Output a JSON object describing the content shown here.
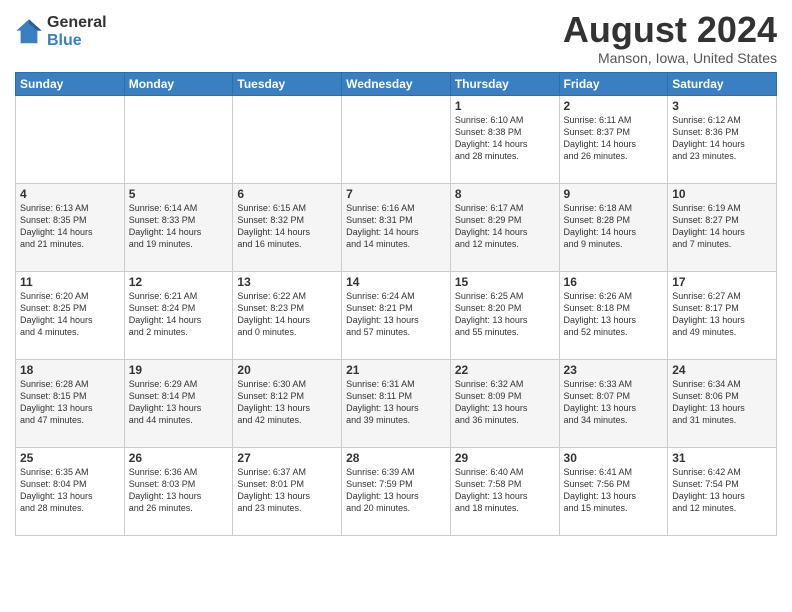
{
  "logo": {
    "general": "General",
    "blue": "Blue"
  },
  "title": "August 2024",
  "location": "Manson, Iowa, United States",
  "days_header": [
    "Sunday",
    "Monday",
    "Tuesday",
    "Wednesday",
    "Thursday",
    "Friday",
    "Saturday"
  ],
  "weeks": [
    [
      {
        "day": "",
        "info": ""
      },
      {
        "day": "",
        "info": ""
      },
      {
        "day": "",
        "info": ""
      },
      {
        "day": "",
        "info": ""
      },
      {
        "day": "1",
        "info": "Sunrise: 6:10 AM\nSunset: 8:38 PM\nDaylight: 14 hours\nand 28 minutes."
      },
      {
        "day": "2",
        "info": "Sunrise: 6:11 AM\nSunset: 8:37 PM\nDaylight: 14 hours\nand 26 minutes."
      },
      {
        "day": "3",
        "info": "Sunrise: 6:12 AM\nSunset: 8:36 PM\nDaylight: 14 hours\nand 23 minutes."
      }
    ],
    [
      {
        "day": "4",
        "info": "Sunrise: 6:13 AM\nSunset: 8:35 PM\nDaylight: 14 hours\nand 21 minutes."
      },
      {
        "day": "5",
        "info": "Sunrise: 6:14 AM\nSunset: 8:33 PM\nDaylight: 14 hours\nand 19 minutes."
      },
      {
        "day": "6",
        "info": "Sunrise: 6:15 AM\nSunset: 8:32 PM\nDaylight: 14 hours\nand 16 minutes."
      },
      {
        "day": "7",
        "info": "Sunrise: 6:16 AM\nSunset: 8:31 PM\nDaylight: 14 hours\nand 14 minutes."
      },
      {
        "day": "8",
        "info": "Sunrise: 6:17 AM\nSunset: 8:29 PM\nDaylight: 14 hours\nand 12 minutes."
      },
      {
        "day": "9",
        "info": "Sunrise: 6:18 AM\nSunset: 8:28 PM\nDaylight: 14 hours\nand 9 minutes."
      },
      {
        "day": "10",
        "info": "Sunrise: 6:19 AM\nSunset: 8:27 PM\nDaylight: 14 hours\nand 7 minutes."
      }
    ],
    [
      {
        "day": "11",
        "info": "Sunrise: 6:20 AM\nSunset: 8:25 PM\nDaylight: 14 hours\nand 4 minutes."
      },
      {
        "day": "12",
        "info": "Sunrise: 6:21 AM\nSunset: 8:24 PM\nDaylight: 14 hours\nand 2 minutes."
      },
      {
        "day": "13",
        "info": "Sunrise: 6:22 AM\nSunset: 8:23 PM\nDaylight: 14 hours\nand 0 minutes."
      },
      {
        "day": "14",
        "info": "Sunrise: 6:24 AM\nSunset: 8:21 PM\nDaylight: 13 hours\nand 57 minutes."
      },
      {
        "day": "15",
        "info": "Sunrise: 6:25 AM\nSunset: 8:20 PM\nDaylight: 13 hours\nand 55 minutes."
      },
      {
        "day": "16",
        "info": "Sunrise: 6:26 AM\nSunset: 8:18 PM\nDaylight: 13 hours\nand 52 minutes."
      },
      {
        "day": "17",
        "info": "Sunrise: 6:27 AM\nSunset: 8:17 PM\nDaylight: 13 hours\nand 49 minutes."
      }
    ],
    [
      {
        "day": "18",
        "info": "Sunrise: 6:28 AM\nSunset: 8:15 PM\nDaylight: 13 hours\nand 47 minutes."
      },
      {
        "day": "19",
        "info": "Sunrise: 6:29 AM\nSunset: 8:14 PM\nDaylight: 13 hours\nand 44 minutes."
      },
      {
        "day": "20",
        "info": "Sunrise: 6:30 AM\nSunset: 8:12 PM\nDaylight: 13 hours\nand 42 minutes."
      },
      {
        "day": "21",
        "info": "Sunrise: 6:31 AM\nSunset: 8:11 PM\nDaylight: 13 hours\nand 39 minutes."
      },
      {
        "day": "22",
        "info": "Sunrise: 6:32 AM\nSunset: 8:09 PM\nDaylight: 13 hours\nand 36 minutes."
      },
      {
        "day": "23",
        "info": "Sunrise: 6:33 AM\nSunset: 8:07 PM\nDaylight: 13 hours\nand 34 minutes."
      },
      {
        "day": "24",
        "info": "Sunrise: 6:34 AM\nSunset: 8:06 PM\nDaylight: 13 hours\nand 31 minutes."
      }
    ],
    [
      {
        "day": "25",
        "info": "Sunrise: 6:35 AM\nSunset: 8:04 PM\nDaylight: 13 hours\nand 28 minutes."
      },
      {
        "day": "26",
        "info": "Sunrise: 6:36 AM\nSunset: 8:03 PM\nDaylight: 13 hours\nand 26 minutes."
      },
      {
        "day": "27",
        "info": "Sunrise: 6:37 AM\nSunset: 8:01 PM\nDaylight: 13 hours\nand 23 minutes."
      },
      {
        "day": "28",
        "info": "Sunrise: 6:39 AM\nSunset: 7:59 PM\nDaylight: 13 hours\nand 20 minutes."
      },
      {
        "day": "29",
        "info": "Sunrise: 6:40 AM\nSunset: 7:58 PM\nDaylight: 13 hours\nand 18 minutes."
      },
      {
        "day": "30",
        "info": "Sunrise: 6:41 AM\nSunset: 7:56 PM\nDaylight: 13 hours\nand 15 minutes."
      },
      {
        "day": "31",
        "info": "Sunrise: 6:42 AM\nSunset: 7:54 PM\nDaylight: 13 hours\nand 12 minutes."
      }
    ]
  ]
}
